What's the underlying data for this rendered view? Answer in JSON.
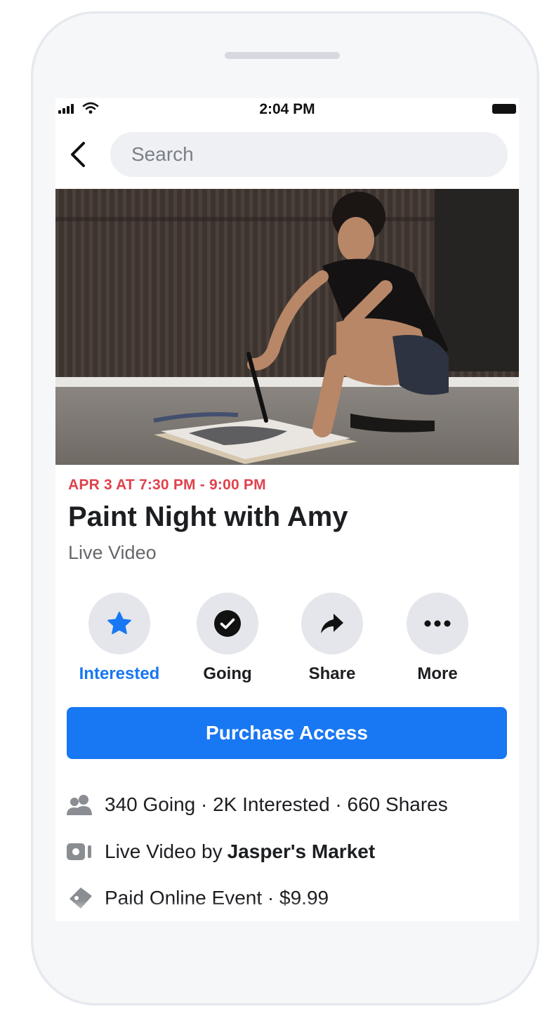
{
  "status_bar": {
    "time": "2:04 PM"
  },
  "search": {
    "placeholder": "Search"
  },
  "event": {
    "date": "APR 3 AT 7:30 PM - 9:00 PM",
    "title": "Paint Night with Amy",
    "subtitle": "Live Video"
  },
  "actions": [
    {
      "label": "Interested",
      "icon": "star-icon",
      "active": true
    },
    {
      "label": "Going",
      "icon": "check-circle-icon",
      "active": false
    },
    {
      "label": "Share",
      "icon": "share-arrow-icon",
      "active": false
    },
    {
      "label": "More",
      "icon": "more-dots-icon",
      "active": false
    }
  ],
  "purchase_label": "Purchase Access",
  "details": {
    "stats": "340 Going · 2K Interested · 660 Shares",
    "host_prefix": "Live Video by",
    "host_name": "Jasper's Market",
    "price": "Paid Online Event · $9.99"
  },
  "colors": {
    "accent": "#1877f2",
    "date_red": "#e0424d",
    "circle_bg": "#e4e6eb"
  }
}
